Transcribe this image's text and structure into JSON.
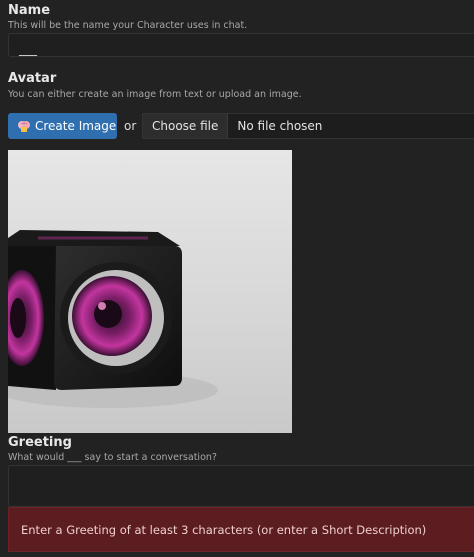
{
  "name_section": {
    "title": "Name",
    "description": "This will be the name your Character uses in chat.",
    "value": "___"
  },
  "avatar_section": {
    "title": "Avatar",
    "description": "You can either create an image from text or upload an image.",
    "create_button_label": "Create Image",
    "create_button_icon": "brain-icon",
    "or_label": "or",
    "choose_file_label": "Choose file",
    "no_file_label": "No file chosen",
    "image_description": "3D rendered black cube with magenta camera lenses"
  },
  "greeting_section": {
    "title": "Greeting",
    "description": "What would ___ say to start a conversation?",
    "value": ""
  },
  "error_banner": {
    "message": "Enter a Greeting of at least 3 characters (or enter a Short Description)"
  },
  "colors": {
    "background": "#222222",
    "accent_button": "#2f6fb0",
    "error_background": "#5c1d21"
  }
}
